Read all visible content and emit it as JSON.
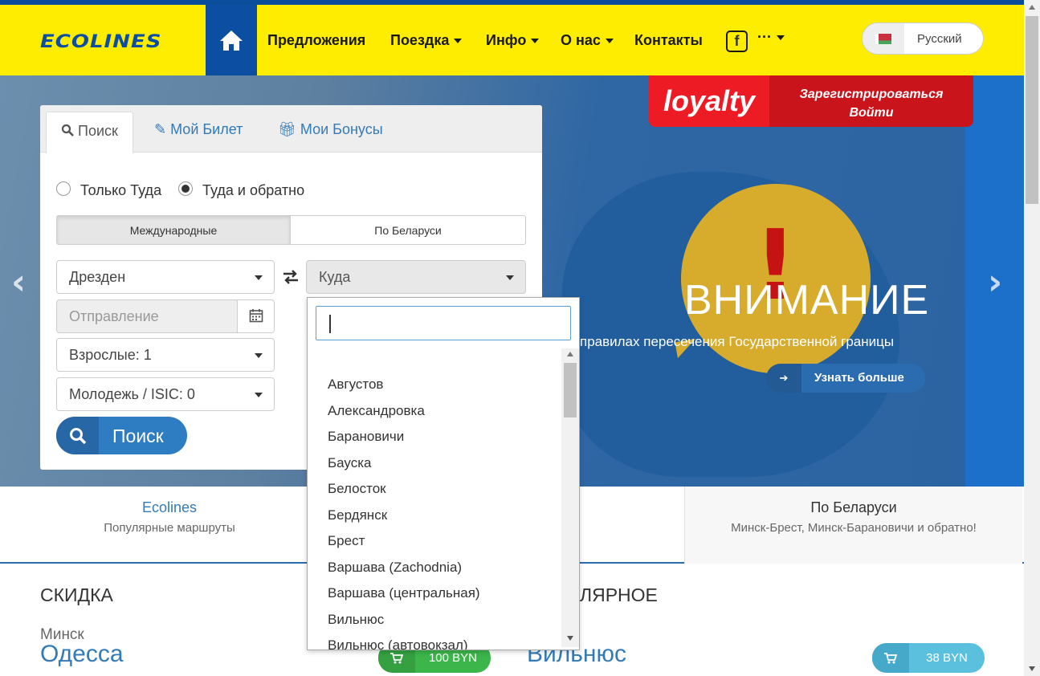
{
  "colors": {
    "brand_yellow": "#ffed00",
    "brand_blue": "#0b4ea2",
    "link_blue": "#337ab7",
    "loyalty_red": "#ed1c24",
    "price_green": "#3cb54a",
    "price_teal": "#5bc0de"
  },
  "header": {
    "logo": "ECOLINES",
    "home_icon": "home-icon",
    "nav": [
      {
        "label": "Предложения",
        "dropdown": false
      },
      {
        "label": "Поездка",
        "dropdown": true
      },
      {
        "label": "Инфо",
        "dropdown": true
      },
      {
        "label": "О нас",
        "dropdown": true
      },
      {
        "label": "Контакты",
        "dropdown": false
      }
    ],
    "facebook": "f",
    "more": "···",
    "language": "Русский"
  },
  "hero": {
    "loyalty_logo": "loyalty",
    "register": "Зарегистрироваться",
    "login": "Войти",
    "attention": "ВНИМАНИЕ",
    "exclamation": "!",
    "rules_text": "правилах пересечения Государственной границы",
    "learn_more": "Узнать больше",
    "prev_arrow": "‹",
    "next_arrow": "›"
  },
  "search": {
    "tabs": [
      "Поиск",
      "Мой Билет",
      "Мои Бонусы"
    ],
    "trip_one_way": "Только Туда",
    "trip_round": "Туда и обратно",
    "segment_international": "Международные",
    "segment_domestic": "По Беларуси",
    "from_value": "Дрезден",
    "to_placeholder": "Куда",
    "departure_placeholder": "Отправление",
    "adults": "Взрослые: 1",
    "youth": "Молодежь / ISIC: 0",
    "search_button": "Поиск"
  },
  "destinations": [
    "Августов",
    "Александровка",
    "Барановичи",
    "Бауска",
    "Белосток",
    "Бердянск",
    "Брест",
    "Варшава (Zachodnia)",
    "Варшава (центральная)",
    "Вильнюс",
    "Вильнюс (автовокзал)"
  ],
  "routes": [
    {
      "title": "Ecolines",
      "subtitle": "Популярные маршруты"
    },
    {
      "title": "По Беларуси",
      "subtitle": "Минск-Брест, Минск-Барановичи и обратно!"
    }
  ],
  "deals": {
    "discount_title": "СКИДКА",
    "popular_title_partial": "ЛЯРНОЕ",
    "discount": {
      "from": "Минск",
      "to": "Одесса",
      "price": "100 BYN"
    },
    "popular": {
      "to": "Вильнюс",
      "price": "38 BYN"
    }
  }
}
